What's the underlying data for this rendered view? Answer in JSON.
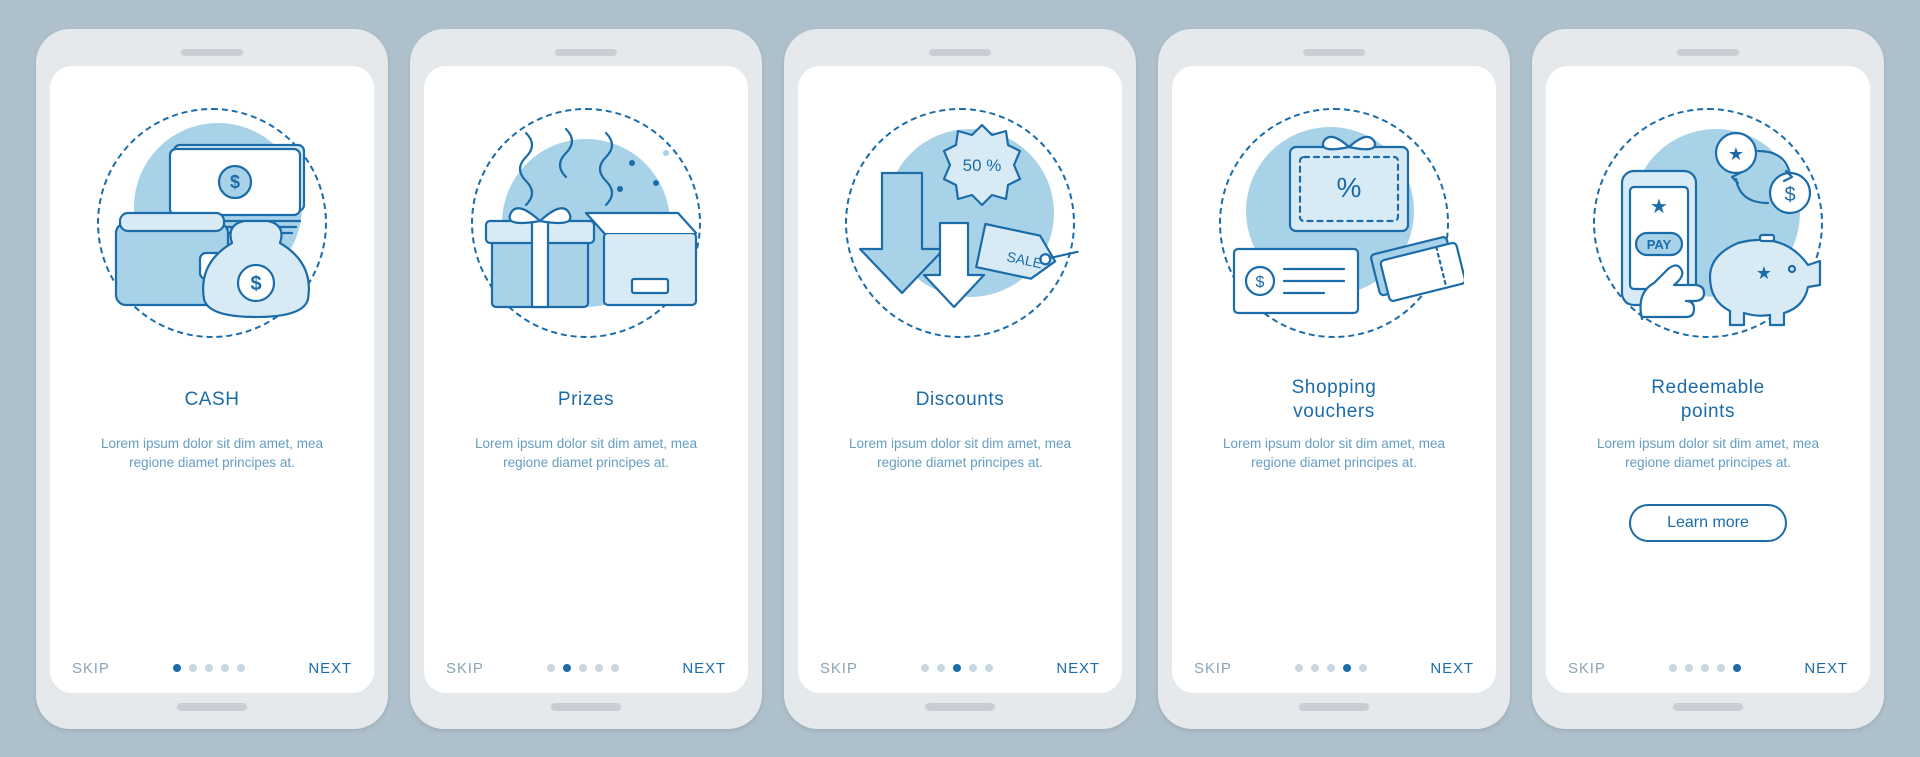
{
  "common": {
    "skip": "SKIP",
    "next": "NEXT",
    "learn_more": "Learn more",
    "lorem": "Lorem ipsum dolor sit dim amet, mea regione diamet principes at."
  },
  "screens": [
    {
      "title": "CASH",
      "icon": "cash"
    },
    {
      "title": "Prizes",
      "icon": "prizes"
    },
    {
      "title": "Discounts",
      "icon": "discounts",
      "discount_pct": "50 %",
      "sale_text": "SALE"
    },
    {
      "title": "Shopping\nvouchers",
      "icon": "vouchers"
    },
    {
      "title": "Redeemable\npoints",
      "icon": "points",
      "pay_text": "PAY",
      "has_cta": true
    }
  ]
}
